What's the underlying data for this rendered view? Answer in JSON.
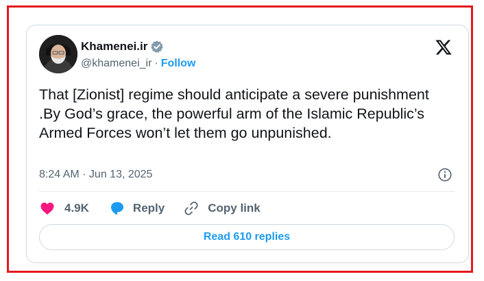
{
  "author": {
    "name": "Khamenei.ir",
    "handle": "@khamenei_ir",
    "separator": "·",
    "follow_label": "Follow"
  },
  "tweet": {
    "text": "That [Zionist] regime should anticipate a severe punishment .By God’s grace, the powerful arm of the Islamic Republic’s Armed Forces won’t let them go unpunished.",
    "timestamp": "8:24 AM · Jun 13, 2025"
  },
  "actions": {
    "likes_count": "4.9K",
    "reply_label": "Reply",
    "copy_link_label": "Copy link"
  },
  "read_replies_label": "Read 610 replies",
  "icons": {
    "verified": "verified-badge-icon",
    "platform": "x-logo-icon",
    "info": "info-icon",
    "like": "heart-icon",
    "reply": "reply-bubble-icon",
    "link": "link-icon"
  },
  "colors": {
    "accent": "#1d9bf0",
    "like": "#f91880",
    "verified": "#829aab",
    "frame_border": "#e4161c",
    "text": "#0f1419",
    "muted": "#536471"
  }
}
